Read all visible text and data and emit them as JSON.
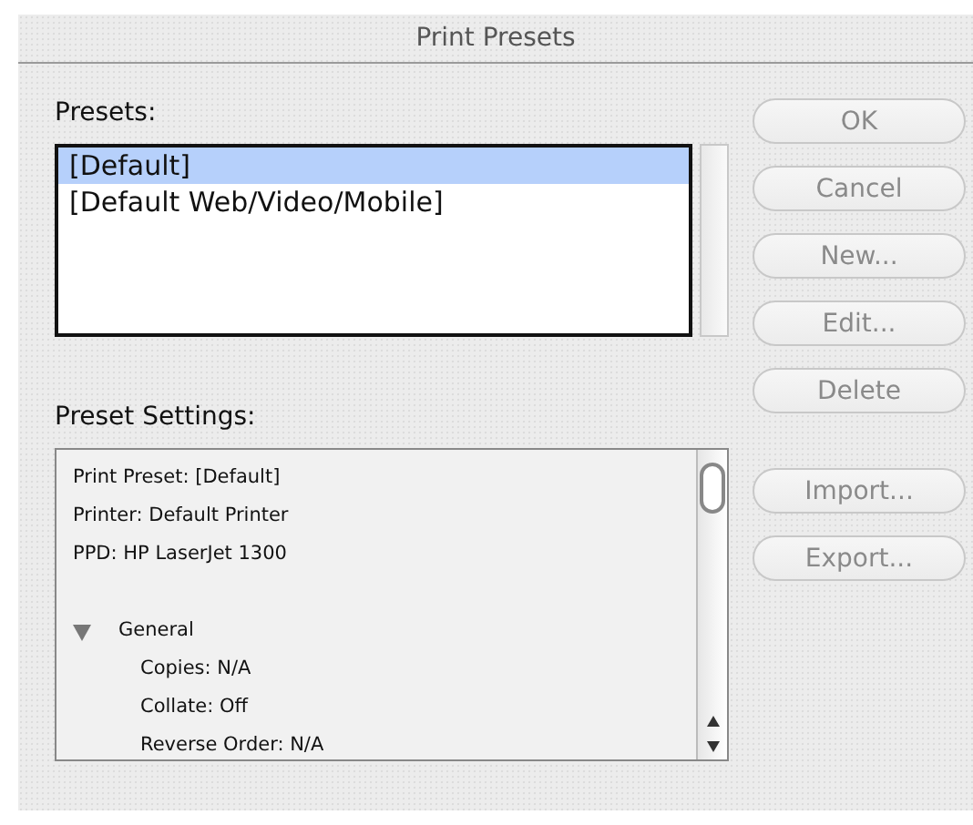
{
  "window": {
    "title": "Print Presets"
  },
  "presets": {
    "label": "Presets:",
    "items": [
      {
        "label": "[Default]",
        "selected": true
      },
      {
        "label": "[Default Web/Video/Mobile]",
        "selected": false
      }
    ]
  },
  "preset_settings": {
    "label": "Preset Settings:",
    "lines": [
      {
        "kind": "line",
        "text": "Print Preset: [Default]"
      },
      {
        "kind": "line",
        "text": "Printer: Default Printer"
      },
      {
        "kind": "line",
        "text": "PPD: HP LaserJet 1300"
      },
      {
        "kind": "gap"
      },
      {
        "kind": "group",
        "text": "General",
        "expanded": true,
        "children": [
          {
            "kind": "line",
            "text": "Copies: N/A"
          },
          {
            "kind": "line",
            "text": "Collate: Off"
          },
          {
            "kind": "line",
            "text": "Reverse Order: N/A"
          }
        ]
      }
    ]
  },
  "buttons": [
    {
      "label": "OK",
      "disabled": true
    },
    {
      "label": "Cancel",
      "disabled": true
    },
    {
      "label": "New...",
      "disabled": true
    },
    {
      "label": "Edit...",
      "disabled": true
    },
    {
      "label": "Delete",
      "disabled": true
    },
    {
      "label": "Import...",
      "disabled": true
    },
    {
      "label": "Export...",
      "disabled": true
    }
  ]
}
